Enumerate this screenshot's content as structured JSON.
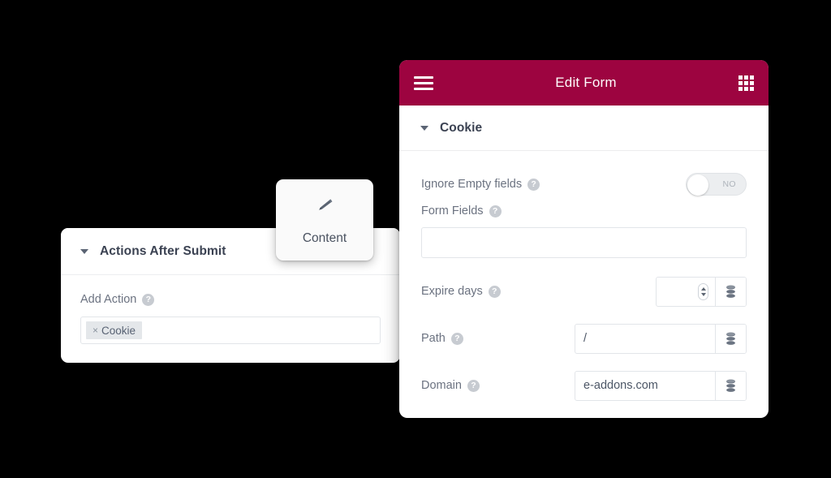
{
  "theme": {
    "header_bg": "#9d0440",
    "header_text": "#ffffff",
    "panel_bg": "#ffffff",
    "label_color": "#6b7280",
    "title_color": "#3b4252",
    "page_bg": "#000000"
  },
  "left_panel": {
    "section": {
      "title": "Actions After Submit",
      "caret_icon": "caret-down-icon"
    },
    "add_action": {
      "label": "Add Action",
      "help_icon": "help-circle-icon",
      "help_glyph": "?",
      "tags": [
        {
          "label": "Cookie",
          "remove_glyph": "×",
          "remove_icon": "remove-tag-icon"
        }
      ]
    }
  },
  "content_tab": {
    "label": "Content",
    "icon": "pencil-icon"
  },
  "right_panel": {
    "header": {
      "title": "Edit Form",
      "menu_icon": "hamburger-menu-icon",
      "apps_icon": "grid-apps-icon"
    },
    "section": {
      "title": "Cookie",
      "caret_icon": "caret-down-icon"
    },
    "fields": [
      {
        "name": "ignore-empty-fields",
        "label": "Ignore Empty fields",
        "help_icon": "help-circle-icon",
        "help_glyph": "?",
        "control": "toggle",
        "toggle_state": "NO"
      },
      {
        "name": "form-fields",
        "label": "Form Fields",
        "help_icon": "help-circle-icon",
        "help_glyph": "?",
        "control": "text-wide",
        "value": "",
        "placeholder": ""
      },
      {
        "name": "expire-days",
        "label": "Expire days",
        "help_icon": "help-circle-icon",
        "help_glyph": "?",
        "control": "number-with-dynamic",
        "value": "",
        "spinner_icon": "spinner-updown-icon",
        "dynamic_icon": "database-stack-icon"
      },
      {
        "name": "path",
        "label": "Path",
        "help_icon": "help-circle-icon",
        "help_glyph": "?",
        "control": "text-with-dynamic",
        "value": "/",
        "dynamic_icon": "database-stack-icon"
      },
      {
        "name": "domain",
        "label": "Domain",
        "help_icon": "help-circle-icon",
        "help_glyph": "?",
        "control": "text-with-dynamic",
        "value": "e-addons.com",
        "dynamic_icon": "database-stack-icon"
      }
    ]
  }
}
